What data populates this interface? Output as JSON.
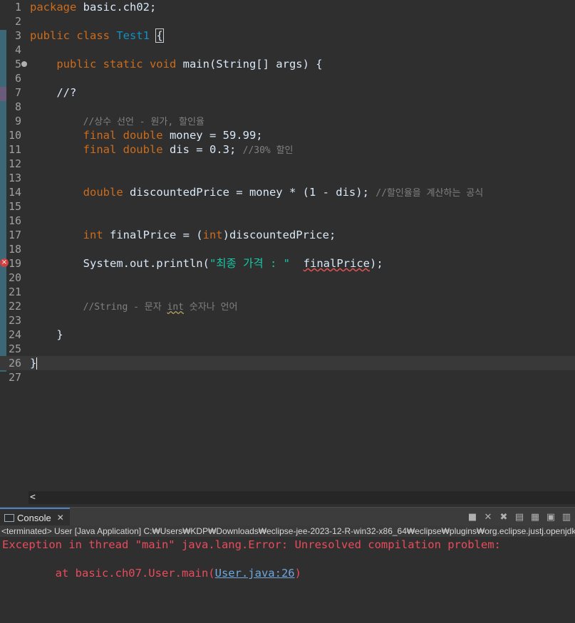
{
  "editor": {
    "lines": [
      {
        "n": "1",
        "html": "<span class=\"kw\">package</span> basic.ch02;"
      },
      {
        "n": "2",
        "html": ""
      },
      {
        "n": "3",
        "html": "<span class=\"kw\">public class</span> <span class=\"cls\">Test1</span> <span class=\"bracebox\">{</span>"
      },
      {
        "n": "4",
        "html": ""
      },
      {
        "n": "5",
        "html": "    <span class=\"kw\">public static void</span> main(String[] args) {",
        "fold": true
      },
      {
        "n": "6",
        "html": ""
      },
      {
        "n": "7",
        "html": "    //?"
      },
      {
        "n": "8",
        "html": ""
      },
      {
        "n": "9",
        "html": "        <span class=\"cm\">//상수 선언 - 원가, 할인율</span>"
      },
      {
        "n": "10",
        "html": "        <span class=\"kw\">final double</span> money = 59.99;"
      },
      {
        "n": "11",
        "html": "        <span class=\"kw\">final double</span> dis = 0.3; <span class=\"cm\">//30% 할인</span>"
      },
      {
        "n": "12",
        "html": ""
      },
      {
        "n": "13",
        "html": ""
      },
      {
        "n": "14",
        "html": "        <span class=\"kw\">double</span> discountedPrice = money * (1 - dis); <span class=\"cm\">//할인율을 계산하는 공식</span>"
      },
      {
        "n": "15",
        "html": ""
      },
      {
        "n": "16",
        "html": ""
      },
      {
        "n": "17",
        "html": "        <span class=\"kw\">int</span> finalPrice = (<span class=\"kw\">int</span>)discountedPrice;"
      },
      {
        "n": "18",
        "html": ""
      },
      {
        "n": "19",
        "html": "        System.out.println(<span class=\"str\">\"최종 가격 : \"</span>  <span class=\"sq\">finalPrice</span>);",
        "error": true
      },
      {
        "n": "20",
        "html": ""
      },
      {
        "n": "21",
        "html": ""
      },
      {
        "n": "22",
        "html": "        <span class=\"cm\">//String - 문자 <span class=\"sqw\">int</span> 숫자나 언어</span>"
      },
      {
        "n": "23",
        "html": ""
      },
      {
        "n": "24",
        "html": "    }"
      },
      {
        "n": "25",
        "html": ""
      },
      {
        "n": "26",
        "html": "}<span class=\"caret\"></span>",
        "current": true
      },
      {
        "n": "27",
        "html": ""
      }
    ]
  },
  "console": {
    "tab_label": "Console",
    "status": "<terminated> User [Java Application] C:₩Users₩KDP₩Downloads₩eclipse-jee-2023-12-R-win32-x86_64₩eclipse₩plugins₩org.eclipse.justj.openjdk.hotspot",
    "error_line": "Exception in thread \"main\" java.lang.Error: Unresolved compilation problem:",
    "trace_prefix": "        at basic.ch07.User.main(",
    "trace_link": "User.java:26",
    "trace_suffix": ")"
  },
  "colors": {
    "editor_bg": "#2f2f2f",
    "keyword": "#cc6c1d",
    "class_name": "#1290c3",
    "comment": "#808080",
    "string": "#17c6a3",
    "error_text": "#e84c5c",
    "link": "#6fa8dc"
  },
  "icons": [
    "fold-collapse-icon",
    "error-marker-icon",
    "scroll-left-icon",
    "console-icon",
    "close-icon",
    "stop-icon",
    "remove-launch-icon",
    "remove-all-icon",
    "pin-console-icon",
    "scroll-lock-icon",
    "word-wrap-icon"
  ]
}
